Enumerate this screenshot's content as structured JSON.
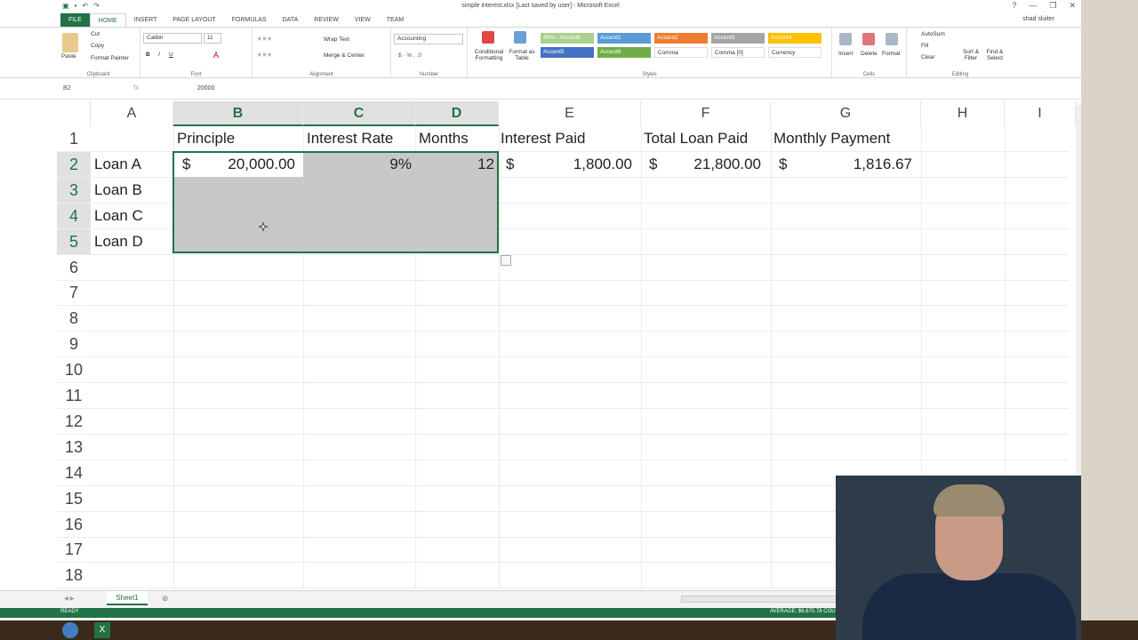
{
  "window": {
    "title": "simple interest.xlsx [Last saved by user] - Microsoft Excel",
    "user_name": "shad sluiter"
  },
  "ribbon_tabs": [
    "FILE",
    "HOME",
    "INSERT",
    "PAGE LAYOUT",
    "FORMULAS",
    "DATA",
    "REVIEW",
    "VIEW",
    "TEAM"
  ],
  "ribbon": {
    "clipboard": {
      "label": "Clipboard",
      "paste": "Paste",
      "cut": "Cut",
      "copy": "Copy",
      "format_painter": "Format Painter"
    },
    "font": {
      "label": "Font",
      "name": "Calibri",
      "size": "11"
    },
    "alignment": {
      "label": "Alignment",
      "wrap": "Wrap Text",
      "merge": "Merge & Center"
    },
    "number": {
      "label": "Number",
      "format": "Accounting"
    },
    "styles": {
      "label": "Styles",
      "conditional": "Conditional Formatting",
      "format_table": "Format as Table",
      "cells": [
        {
          "label": "40% - Accent6",
          "color": "#a9d08e"
        },
        {
          "label": "Accent1",
          "color": "#5b9bd5"
        },
        {
          "label": "Accent2",
          "color": "#ed7d31"
        },
        {
          "label": "Accent3",
          "color": "#a5a5a5"
        },
        {
          "label": "Accent4",
          "color": "#ffc000"
        },
        {
          "label": "Accent5",
          "color": "#4472c4"
        },
        {
          "label": "Accent6",
          "color": "#70ad47"
        },
        {
          "label": "Comma",
          "color": "#ffffff"
        },
        {
          "label": "Comma [0]",
          "color": "#ffffff"
        },
        {
          "label": "Currency",
          "color": "#ffffff"
        }
      ]
    },
    "cells_group": {
      "label": "Cells",
      "insert": "Insert",
      "delete": "Delete",
      "format": "Format"
    },
    "editing": {
      "label": "Editing",
      "autosum": "AutoSum",
      "fill": "Fill",
      "clear": "Clear",
      "sort": "Sort & Filter",
      "find": "Find & Select"
    }
  },
  "formula_bar": {
    "name_box": "B2",
    "fx": "fx",
    "content": "20000"
  },
  "columns": [
    "A",
    "B",
    "C",
    "D",
    "E",
    "F",
    "G",
    "H",
    "I"
  ],
  "rows": [
    "1",
    "2",
    "3",
    "4",
    "5",
    "6",
    "7",
    "8",
    "9",
    "10",
    "11",
    "12",
    "13",
    "14",
    "15",
    "16",
    "17",
    "18"
  ],
  "cells": {
    "B1": "Principle",
    "C1": "Interest Rate",
    "D1": "Months",
    "E1": "Interest Paid",
    "F1": "Total Loan Paid",
    "G1": "Monthly Payment",
    "A2": "Loan A",
    "A3": "Loan B",
    "A4": "Loan C",
    "A5": "Loan D",
    "B2_sym": "$",
    "B2": "20,000.00",
    "C2": "9%",
    "D2": "12",
    "E2_sym": "$",
    "E2": "1,800.00",
    "F2_sym": "$",
    "F2": "21,800.00",
    "G2_sym": "$",
    "G2": "1,816.67"
  },
  "sheet_tab": "Sheet1",
  "status": {
    "ready": "READY",
    "summary": "AVERAGE: $6,670.78    COUNT: 3"
  }
}
